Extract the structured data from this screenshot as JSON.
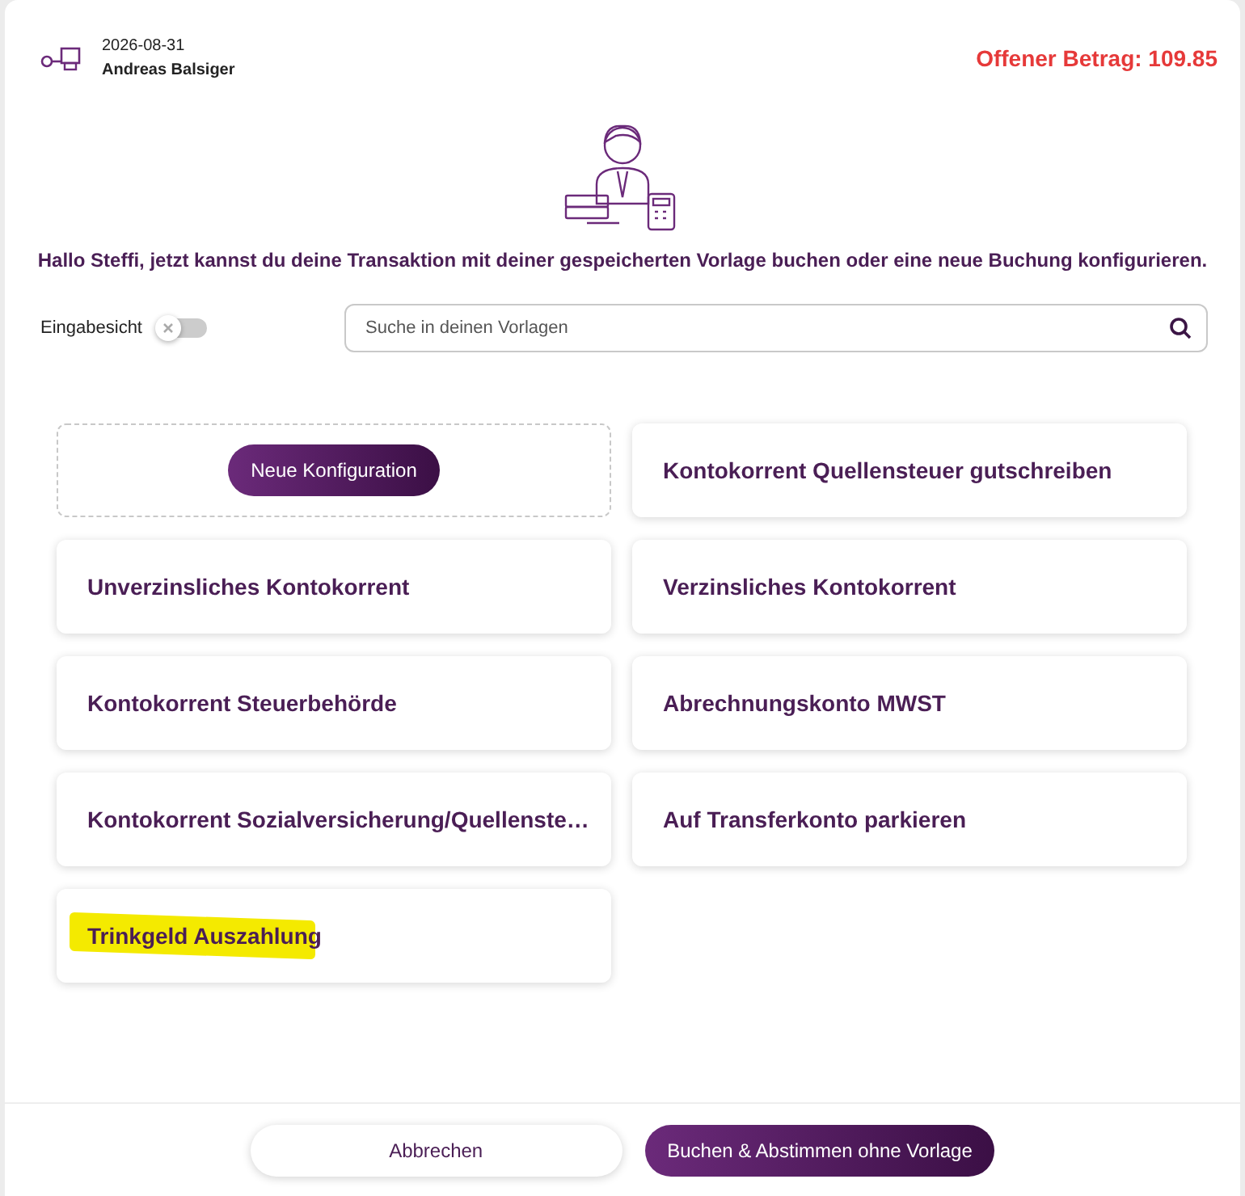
{
  "header": {
    "date": "2026-08-31",
    "name": "Andreas Balsiger",
    "open_amount": "Offener Betrag: 109.85"
  },
  "greeting": "Hallo Steffi, jetzt kannst du deine Transaktion mit deiner gespeicherten Vorlage buchen oder eine neue Buchung konfigurieren.",
  "input_view": {
    "label": "Eingabesicht",
    "on": false
  },
  "search": {
    "placeholder": "Suche in deinen Vorlagen"
  },
  "templates": [
    {
      "kind": "new",
      "label": "Neue Konfiguration"
    },
    {
      "kind": "template",
      "label": "Kontokorrent Quellensteuer gutschreiben",
      "highlighted": false
    },
    {
      "kind": "template",
      "label": "Unverzinsliches Kontokorrent",
      "highlighted": false
    },
    {
      "kind": "template",
      "label": "Verzinsliches Kontokorrent",
      "highlighted": false
    },
    {
      "kind": "template",
      "label": "Kontokorrent Steuerbehörde",
      "highlighted": false
    },
    {
      "kind": "template",
      "label": "Abrechnungskonto MWST",
      "highlighted": false
    },
    {
      "kind": "template",
      "label": "Kontokorrent Sozialversicherung/Quellenste…",
      "highlighted": false
    },
    {
      "kind": "template",
      "label": "Auf Transferkonto parkieren",
      "highlighted": false
    },
    {
      "kind": "template",
      "label": "Trinkgeld Auszahlung",
      "highlighted": true
    }
  ],
  "footer": {
    "cancel": "Abbrechen",
    "book": "Buchen & Abstimmen ohne Vorlage"
  }
}
